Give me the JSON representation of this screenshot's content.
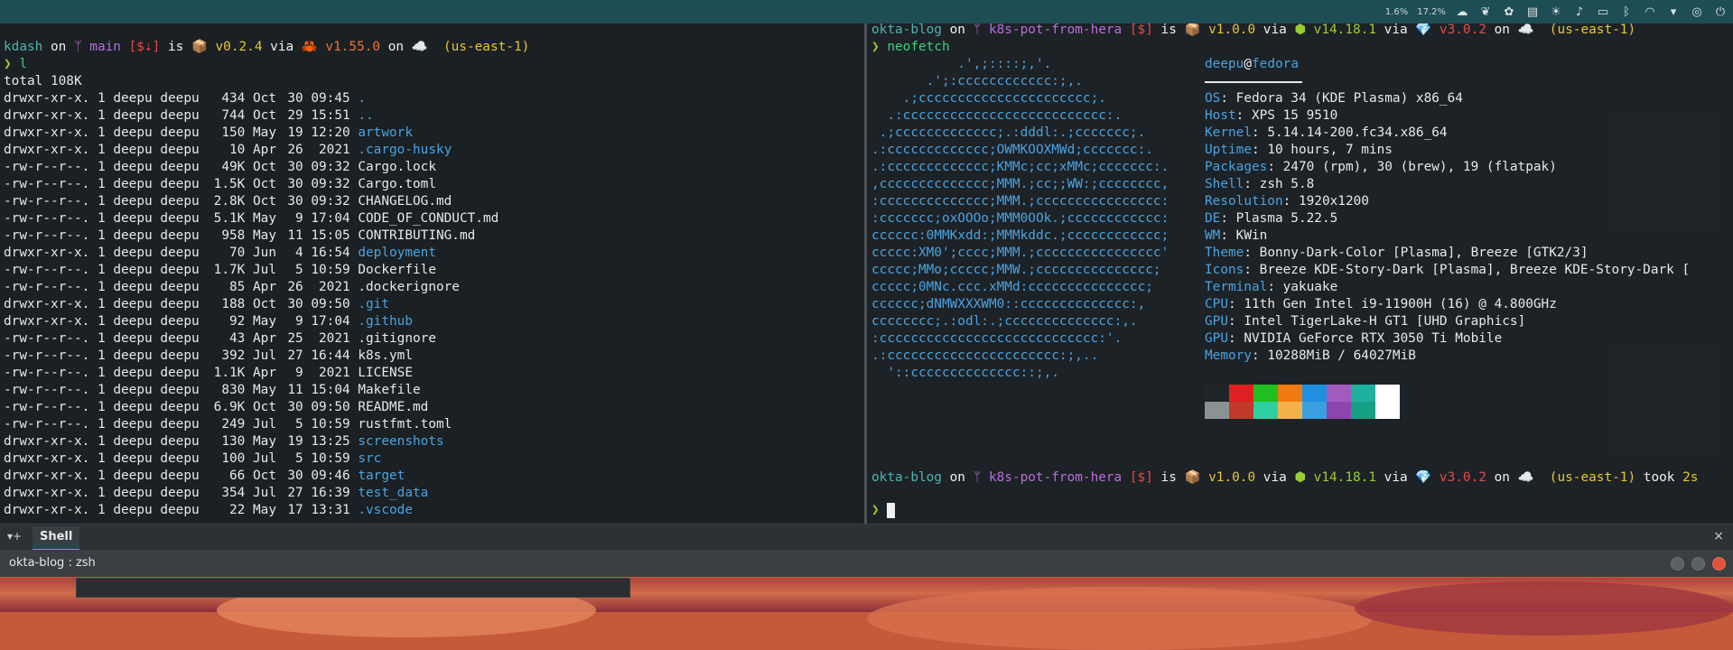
{
  "top_panel": {
    "cpu1": "1.6%",
    "cpu2": "17.2%",
    "icons": [
      "weather-icon",
      "leaf-icon",
      "app-icon",
      "clipboard-icon",
      "brightness-icon",
      "volume-icon",
      "battery-icon",
      "bluetooth-icon",
      "wifi-icon",
      "expand-icon",
      "user-icon",
      "power-icon"
    ]
  },
  "left_pane": {
    "prompt": {
      "dir": "kdash",
      "on": " on ",
      "branch": "ᛘ main",
      "status": " [$⇣]",
      "is": " is ",
      "pkg": "📦 v0.2.4",
      "via": " via ",
      "lang": "🦀 v1.55.0",
      "on2": " on ",
      "cloud": "☁️  (us-east-1)"
    },
    "command": "l",
    "total": "total 108K",
    "files": [
      {
        "perm": "drwxr-xr-x.",
        "links": "1",
        "user": "deepu",
        "group": "deepu",
        "size": "434",
        "month": "Oct",
        "day": "30",
        "time": "09:45",
        "name": ".",
        "kind": "dir"
      },
      {
        "perm": "drwxr-xr-x.",
        "links": "1",
        "user": "deepu",
        "group": "deepu",
        "size": "744",
        "month": "Oct",
        "day": "29",
        "time": "15:51",
        "name": "..",
        "kind": "dir"
      },
      {
        "perm": "drwxr-xr-x.",
        "links": "1",
        "user": "deepu",
        "group": "deepu",
        "size": "150",
        "month": "May",
        "day": "19",
        "time": "12:20",
        "name": "artwork",
        "kind": "dir"
      },
      {
        "perm": "drwxr-xr-x.",
        "links": "1",
        "user": "deepu",
        "group": "deepu",
        "size": "10",
        "month": "Apr",
        "day": "26",
        "time": " 2021",
        "name": ".cargo-husky",
        "kind": "dir"
      },
      {
        "perm": "-rw-r--r--.",
        "links": "1",
        "user": "deepu",
        "group": "deepu",
        "size": "49K",
        "month": "Oct",
        "day": "30",
        "time": "09:32",
        "name": "Cargo.lock",
        "kind": "file"
      },
      {
        "perm": "-rw-r--r--.",
        "links": "1",
        "user": "deepu",
        "group": "deepu",
        "size": "1.5K",
        "month": "Oct",
        "day": "30",
        "time": "09:32",
        "name": "Cargo.toml",
        "kind": "file"
      },
      {
        "perm": "-rw-r--r--.",
        "links": "1",
        "user": "deepu",
        "group": "deepu",
        "size": "2.8K",
        "month": "Oct",
        "day": "30",
        "time": "09:32",
        "name": "CHANGELOG.md",
        "kind": "file"
      },
      {
        "perm": "-rw-r--r--.",
        "links": "1",
        "user": "deepu",
        "group": "deepu",
        "size": "5.1K",
        "month": "May",
        "day": "9",
        "time": "17:04",
        "name": "CODE_OF_CONDUCT.md",
        "kind": "file"
      },
      {
        "perm": "-rw-r--r--.",
        "links": "1",
        "user": "deepu",
        "group": "deepu",
        "size": "958",
        "month": "May",
        "day": "11",
        "time": "15:05",
        "name": "CONTRIBUTING.md",
        "kind": "file"
      },
      {
        "perm": "drwxr-xr-x.",
        "links": "1",
        "user": "deepu",
        "group": "deepu",
        "size": "70",
        "month": "Jun",
        "day": "4",
        "time": "16:54",
        "name": "deployment",
        "kind": "dir"
      },
      {
        "perm": "-rw-r--r--.",
        "links": "1",
        "user": "deepu",
        "group": "deepu",
        "size": "1.7K",
        "month": "Jul",
        "day": "5",
        "time": "10:59",
        "name": "Dockerfile",
        "kind": "file"
      },
      {
        "perm": "-rw-r--r--.",
        "links": "1",
        "user": "deepu",
        "group": "deepu",
        "size": "85",
        "month": "Apr",
        "day": "26",
        "time": " 2021",
        "name": ".dockerignore",
        "kind": "file"
      },
      {
        "perm": "drwxr-xr-x.",
        "links": "1",
        "user": "deepu",
        "group": "deepu",
        "size": "188",
        "month": "Oct",
        "day": "30",
        "time": "09:50",
        "name": ".git",
        "kind": "dir"
      },
      {
        "perm": "drwxr-xr-x.",
        "links": "1",
        "user": "deepu",
        "group": "deepu",
        "size": "92",
        "month": "May",
        "day": "9",
        "time": "17:04",
        "name": ".github",
        "kind": "dir"
      },
      {
        "perm": "-rw-r--r--.",
        "links": "1",
        "user": "deepu",
        "group": "deepu",
        "size": "43",
        "month": "Apr",
        "day": "25",
        "time": " 2021",
        "name": ".gitignore",
        "kind": "file"
      },
      {
        "perm": "-rw-r--r--.",
        "links": "1",
        "user": "deepu",
        "group": "deepu",
        "size": "392",
        "month": "Jul",
        "day": "27",
        "time": "16:44",
        "name": "k8s.yml",
        "kind": "file"
      },
      {
        "perm": "-rw-r--r--.",
        "links": "1",
        "user": "deepu",
        "group": "deepu",
        "size": "1.1K",
        "month": "Apr",
        "day": "9",
        "time": " 2021",
        "name": "LICENSE",
        "kind": "file"
      },
      {
        "perm": "-rw-r--r--.",
        "links": "1",
        "user": "deepu",
        "group": "deepu",
        "size": "830",
        "month": "May",
        "day": "11",
        "time": "15:04",
        "name": "Makefile",
        "kind": "file"
      },
      {
        "perm": "-rw-r--r--.",
        "links": "1",
        "user": "deepu",
        "group": "deepu",
        "size": "6.9K",
        "month": "Oct",
        "day": "30",
        "time": "09:50",
        "name": "README.md",
        "kind": "file"
      },
      {
        "perm": "-rw-r--r--.",
        "links": "1",
        "user": "deepu",
        "group": "deepu",
        "size": "249",
        "month": "Jul",
        "day": "5",
        "time": "10:59",
        "name": "rustfmt.toml",
        "kind": "file"
      },
      {
        "perm": "drwxr-xr-x.",
        "links": "1",
        "user": "deepu",
        "group": "deepu",
        "size": "130",
        "month": "May",
        "day": "19",
        "time": "13:25",
        "name": "screenshots",
        "kind": "dir"
      },
      {
        "perm": "drwxr-xr-x.",
        "links": "1",
        "user": "deepu",
        "group": "deepu",
        "size": "100",
        "month": "Jul",
        "day": "5",
        "time": "10:59",
        "name": "src",
        "kind": "dir"
      },
      {
        "perm": "drwxr-xr-x.",
        "links": "1",
        "user": "deepu",
        "group": "deepu",
        "size": "66",
        "month": "Oct",
        "day": "30",
        "time": "09:46",
        "name": "target",
        "kind": "dir"
      },
      {
        "perm": "drwxr-xr-x.",
        "links": "1",
        "user": "deepu",
        "group": "deepu",
        "size": "354",
        "month": "Jul",
        "day": "27",
        "time": "16:39",
        "name": "test_data",
        "kind": "dir"
      },
      {
        "perm": "drwxr-xr-x.",
        "links": "1",
        "user": "deepu",
        "group": "deepu",
        "size": "22",
        "month": "May",
        "day": "17",
        "time": "13:31",
        "name": ".vscode",
        "kind": "dir"
      }
    ]
  },
  "right_pane": {
    "prompt": {
      "dir": "okta-blog",
      "on": " on ",
      "branch": "ᛘ k8s-pot-from-hera",
      "status": " [$]",
      "is": " is ",
      "pkg": "📦 v1.0.0",
      "via": " via ",
      "node": "⬢ v14.18.1",
      "via2": " via ",
      "ruby": "💎 v3.0.2",
      "on2": " on ",
      "cloud": "☁️  (us-east-1)"
    },
    "command": "neofetch",
    "logo_lines": [
      "           .',;::::;,'.",
      "       .';:cccccccccccc:;,.",
      "    .;cccccccccccccccccccccc;.",
      "  .:cccccccccccccccccccccccccc:.",
      " .;ccccccccccccc;.:dddl:.;ccccccc;.",
      ".:ccccccccccccc;OWMKOOXMWd;ccccccc:.",
      ".:ccccccccccccc;KMMc;cc;xMMc;ccccccc:.",
      ",cccccccccccccc;MMM.;cc;;WW:;cccccccc,",
      ":cccccccccccccc;MMM.;cccccccccccccccc:",
      ":ccccccc;oxOOOo;MMM0OOk.;cccccccccccc:",
      "cccccc:0MMKxdd:;MMMkddc.;cccccccccccc;",
      "ccccc:XM0';cccc;MMM.;cccccccccccccccc'",
      "ccccc;MMo;ccccc;MMW.;ccccccccccccccc;",
      "ccccc;0MNc.ccc.xMMd:ccccccccccccccc;",
      "cccccc;dNMWXXXWM0::cccccccccccccc:,",
      "cccccccc;.:odl:.;cccccccccccccc:,.",
      ":cccccccccccccccccccccccccccc:'.",
      ".:cccccccccccccccccccccc:;,..",
      "  '::cccccccccccccc::;,."
    ],
    "user": "deepu",
    "at": "@",
    "host": "fedora",
    "info": [
      {
        "key": "OS",
        "value": "Fedora 34 (KDE Plasma) x86_64"
      },
      {
        "key": "Host",
        "value": "XPS 15 9510"
      },
      {
        "key": "Kernel",
        "value": "5.14.14-200.fc34.x86_64"
      },
      {
        "key": "Uptime",
        "value": "10 hours, 7 mins"
      },
      {
        "key": "Packages",
        "value": "2470 (rpm), 30 (brew), 19 (flatpak)"
      },
      {
        "key": "Shell",
        "value": "zsh 5.8"
      },
      {
        "key": "Resolution",
        "value": "1920x1200"
      },
      {
        "key": "DE",
        "value": "Plasma 5.22.5"
      },
      {
        "key": "WM",
        "value": "KWin"
      },
      {
        "key": "Theme",
        "value": "Bonny-Dark-Color [Plasma], Breeze [GTK2/3]"
      },
      {
        "key": "Icons",
        "value": "Breeze KDE-Story-Dark [Plasma], Breeze KDE-Story-Dark ["
      },
      {
        "key": "Terminal",
        "value": "yakuake"
      },
      {
        "key": "CPU",
        "value": "11th Gen Intel i9-11900H (16) @ 4.800GHz"
      },
      {
        "key": "GPU",
        "value": "Intel TigerLake-H GT1 [UHD Graphics]"
      },
      {
        "key": "GPU",
        "value": "NVIDIA GeForce RTX 3050 Ti Mobile"
      },
      {
        "key": "Memory",
        "value": "10288MiB / 64027MiB"
      }
    ],
    "palette_top": [
      "#1e2427",
      "#e02020",
      "#1fbf1f",
      "#f07b10",
      "#1f8fe0",
      "#a05bc0",
      "#1fb0a0",
      "#ffffff"
    ],
    "palette_bottom": [
      "#8a9294",
      "#c0392b",
      "#2ed0a0",
      "#f4b24a",
      "#3aa0e0",
      "#8e44ad",
      "#16a085",
      "#ffffff"
    ],
    "prompt2_took": " took ",
    "prompt2_time": "2s"
  },
  "tab_bar": {
    "new_tab_label": "▾+",
    "tab_label": "Shell",
    "close_label": "×"
  },
  "title_bar": {
    "title": "okta-blog : zsh"
  }
}
